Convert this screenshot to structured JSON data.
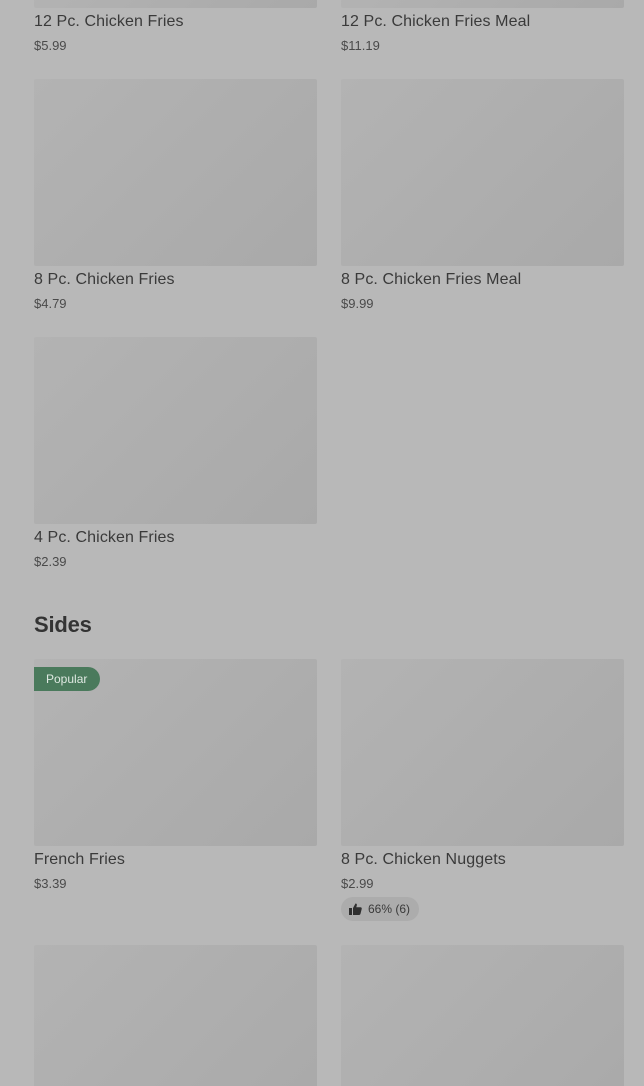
{
  "chicken_fries_items": [
    {
      "name": "12 Pc. Chicken Fries",
      "price": "$5.99"
    },
    {
      "name": "12 Pc. Chicken Fries Meal",
      "price": "$11.19"
    },
    {
      "name": "8 Pc. Chicken Fries",
      "price": "$4.79"
    },
    {
      "name": "8 Pc. Chicken Fries Meal",
      "price": "$9.99"
    },
    {
      "name": "4 Pc. Chicken Fries",
      "price": "$2.39"
    }
  ],
  "sides": {
    "title": "Sides",
    "items": [
      {
        "name": "French Fries",
        "price": "$3.39",
        "badge": "Popular"
      },
      {
        "name": "8 Pc. Chicken Nuggets",
        "price": "$2.99",
        "rating": "66% (6)",
        "rating_icon": "thumbs-up-icon"
      },
      {
        "name": "",
        "price": ""
      },
      {
        "name": "",
        "price": ""
      }
    ]
  },
  "colors": {
    "overlay_background": "#b8b8b8",
    "badge_green": "#4a7a5c"
  }
}
